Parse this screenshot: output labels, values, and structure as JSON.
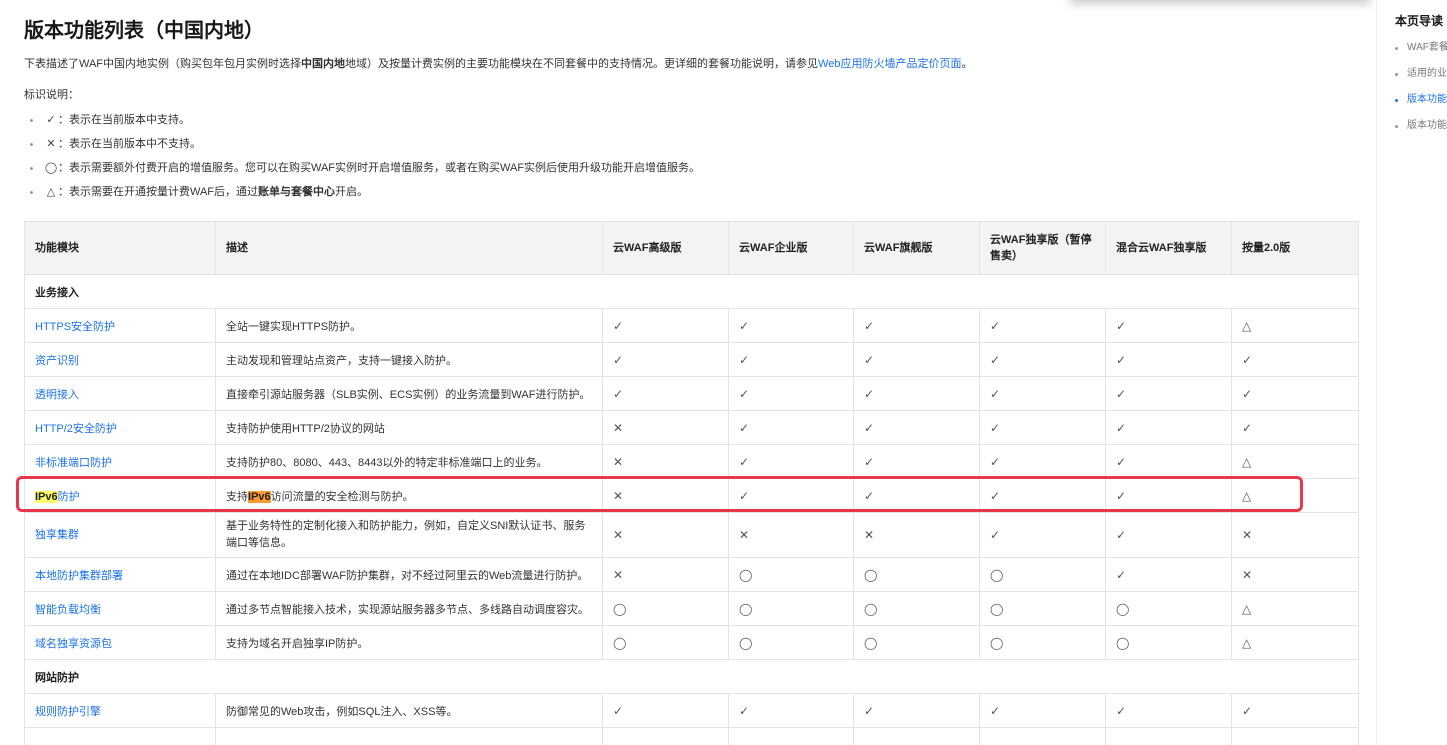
{
  "page": {
    "title": "版本功能列表（中国内地）",
    "desc_prefix": "下表描述了WAF中国内地实例（购买包年包月实例时选择",
    "desc_bold": "中国内地",
    "desc_middle": "地域）及按量计费实例的主要功能模块在不同套餐中的支持情况。更详细的套餐功能说明，请参见",
    "desc_link": "Web应用防火墙产品定价页面",
    "desc_suffix": "。",
    "legend_head": "标识说明：",
    "legend": [
      {
        "symbol": "✓",
        "text": "：表示在当前版本中支持。"
      },
      {
        "symbol": "✕",
        "text": "：表示在当前版本中不支持。"
      },
      {
        "symbol": "◯",
        "text": "：表示需要额外付费开启的增值服务。您可以在购买WAF实例时开启增值服务，或者在购买WAF实例后使用升级功能开启增值服务。"
      },
      {
        "symbol": "△",
        "text": "：表示需要在开通按量计费WAF后，通过",
        "bold": "账单与套餐中心",
        "suffix": "开启。"
      }
    ]
  },
  "table": {
    "headers": [
      "功能模块",
      "描述",
      "云WAF高级版",
      "云WAF企业版",
      "云WAF旗舰版",
      "云WAF独享版（暂停售卖）",
      "混合云WAF独享版",
      "按量2.0版"
    ],
    "section1": "业务接入",
    "rows1": [
      {
        "name": "HTTPS安全防护",
        "desc": "全站一键实现HTTPS防护。",
        "marks": [
          "✓",
          "✓",
          "✓",
          "✓",
          "✓",
          "△"
        ]
      },
      {
        "name": "资产识别",
        "desc": "主动发现和管理站点资产，支持一键接入防护。",
        "marks": [
          "✓",
          "✓",
          "✓",
          "✓",
          "✓",
          "✓"
        ]
      },
      {
        "name": "透明接入",
        "desc": "直接牵引源站服务器（SLB实例、ECS实例）的业务流量到WAF进行防护。",
        "marks": [
          "✓",
          "✓",
          "✓",
          "✓",
          "✓",
          "✓"
        ]
      },
      {
        "name": "HTTP/2安全防护",
        "desc": "支持防护使用HTTP/2协议的网站",
        "marks": [
          "✕",
          "✓",
          "✓",
          "✓",
          "✓",
          "✓"
        ]
      },
      {
        "name": "非标准端口防护",
        "desc": "支持防护80、8080、443、8443以外的特定非标准端口上的业务。",
        "marks": [
          "✕",
          "✓",
          "✓",
          "✓",
          "✓",
          "△"
        ]
      }
    ],
    "ipv6": {
      "name_hl": "IPv6",
      "name_rest": "防护",
      "desc_pre": "支持",
      "desc_hl": "IPv6",
      "desc_rest": "访问流量的安全检测与防护。",
      "marks": [
        "✕",
        "✓",
        "✓",
        "✓",
        "✓",
        "△"
      ]
    },
    "rows2": [
      {
        "name": "独享集群",
        "desc": "基于业务特性的定制化接入和防护能力，例如，自定义SNI默认证书、服务端口等信息。",
        "marks": [
          "✕",
          "✕",
          "✕",
          "✓",
          "✓",
          "✕"
        ]
      },
      {
        "name": "本地防护集群部署",
        "desc": "通过在本地IDC部署WAF防护集群，对不经过阿里云的Web流量进行防护。",
        "marks": [
          "✕",
          "◯",
          "◯",
          "◯",
          "✓",
          "✕"
        ]
      },
      {
        "name": "智能负载均衡",
        "desc": "通过多节点智能接入技术，实现源站服务器多节点、多线路自动调度容灾。",
        "marks": [
          "◯",
          "◯",
          "◯",
          "◯",
          "◯",
          "△"
        ]
      },
      {
        "name": "域名独享资源包",
        "desc": "支持为域名开启独享IP防护。",
        "marks": [
          "◯",
          "◯",
          "◯",
          "◯",
          "◯",
          "△"
        ]
      }
    ],
    "section2": "网站防护",
    "rows3": [
      {
        "name": "规则防护引擎",
        "desc": "防御常见的Web攻击，例如SQL注入、XSS等。",
        "marks": [
          "✓",
          "✓",
          "✓",
          "✓",
          "✓",
          "✓"
        ]
      }
    ]
  },
  "right_nav": {
    "title": "本页导读",
    "items": [
      {
        "label": "WAF套餐",
        "active": false
      },
      {
        "label": "适用的业",
        "active": false
      },
      {
        "label": "版本功能",
        "active": true
      },
      {
        "label": "版本功能",
        "active": false
      }
    ]
  },
  "colors": {
    "link": "#1a73e8",
    "highlight_box": "#e8364a",
    "highlight_yellow": "#ffff66",
    "highlight_orange": "#ff9933"
  }
}
